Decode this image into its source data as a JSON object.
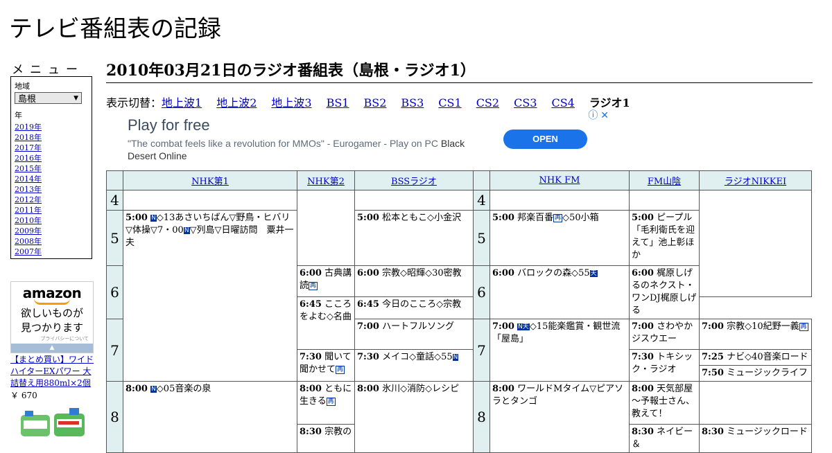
{
  "site": {
    "title": "テレビ番組表の記録"
  },
  "sidebar": {
    "menu_heading": "メニュー",
    "region_label": "地域",
    "region_value": "島根",
    "year_label": "年",
    "years": [
      "2019年",
      "2018年",
      "2017年",
      "2016年",
      "2015年",
      "2014年",
      "2013年",
      "2012年",
      "2011年",
      "2010年",
      "2009年",
      "2008年",
      "2007年"
    ]
  },
  "amazon_ad": {
    "logo": "amazon",
    "copy_line1": "欲しいものが",
    "copy_line2": "見つかります",
    "privacy": "プライバシーについて",
    "product_link": "【まとめ買い】ワイドハイターEXパワー 大詰替え用880ml×2個",
    "product_price": "￥ 670"
  },
  "main": {
    "heading": "2010年03月21日のラジオ番組表（島根・ラジオ1）",
    "switch_label": "表示切替：",
    "switch_links": [
      "地上波1",
      "地上波2",
      "地上波3",
      "BS1",
      "BS2",
      "BS3",
      "CS1",
      "CS2",
      "CS3",
      "CS4"
    ],
    "switch_current": "ラジオ1"
  },
  "ad": {
    "title": "Play for free",
    "desc": "\"The combat feels like a revolution for MMOs\" - Eurogamer - Play on PC",
    "desc_brand": "Black Desert Online",
    "button": "OPEN",
    "icons": "ⓘ ✕"
  },
  "schedule": {
    "channels": [
      "NHK第1",
      "NHK第2",
      "BSSラジオ",
      "NHK FM",
      "FM山陰",
      "ラジオNIKKEI"
    ],
    "hours": [
      "4",
      "5",
      "6",
      "7",
      "8"
    ],
    "programs": {
      "nhk1_500_time": "5:00",
      "nhk1_500_text": "◇13あさいちばん▽野鳥・ヒバリ▽体操▽7・00",
      "nhk1_500_text2": "▽列島▽日曜訪問　粟井一夫",
      "nhk1_800_time": "8:00",
      "nhk1_800_text": "◇05音楽の泉",
      "nhk2_600_time": "6:00",
      "nhk2_600_text": "古典講読",
      "nhk2_645_time": "6:45",
      "nhk2_645_text": "こころをよむ◇名曲",
      "nhk2_730_time": "7:30",
      "nhk2_730_text": "聞いて聞かせて",
      "nhk2_800_time": "8:00",
      "nhk2_800_text": "ともに生きる",
      "nhk2_830_time": "8:30",
      "nhk2_830_text": "宗教の",
      "bss_500_time": "5:00",
      "bss_500_text": "松本ともこ◇小金沢",
      "bss_600_time": "6:00",
      "bss_600_text": "宗教◇昭輝◇30密教",
      "bss_645_time": "6:45",
      "bss_645_text": "今日のこころ◇宗教",
      "bss_700_time": "7:00",
      "bss_700_text": "ハートフルソング",
      "bss_730_time": "7:30",
      "bss_730_text": "メイコ◇童話◇55",
      "bss_800_time": "8:00",
      "bss_800_text": "氷川◇消防◇レシピ",
      "fm_500_time": "5:00",
      "fm_500_text": "邦楽百番",
      "fm_500_text2": "◇50小箱",
      "fm_600_time": "6:00",
      "fm_600_text": "バロックの森◇55",
      "fm_700_time": "7:00",
      "fm_700_text": "◇15能楽鑑賞・観世流「屋島」",
      "fm_800_time": "8:00",
      "fm_800_text": "ワールドMタイム▽ピアソラとタンゴ",
      "san_500_time": "5:00",
      "san_500_text": "ピープル「毛利衛氏を迎えて」池上彰ほか",
      "san_600_time": "6:00",
      "san_600_text": "梶原しげるのネクスト・ワンDJ梶原しげる",
      "san_700_time": "7:00",
      "san_700_text": "さわやかジスウエー",
      "san_730_time": "7:30",
      "san_730_text": "トキシック・ラジオ",
      "san_800_time": "8:00",
      "san_800_text": "天気部屋～予報士さん、教えて！",
      "san_830_time": "8:30",
      "san_830_text": "ネイビー＆",
      "nik_700_time": "7:00",
      "nik_700_text": "宗教◇10紀野一義",
      "nik_725_time": "7:25",
      "nik_725_text": "ナビ◇40音楽ロード",
      "nik_750_time": "7:50",
      "nik_750_text": "ミュージックライフ",
      "nik_830_time": "8:30",
      "nik_830_text": "ミュージックロード"
    },
    "badges": {
      "news": "N",
      "re": "再",
      "stereo": "天",
      "newsweather": "N天"
    }
  }
}
